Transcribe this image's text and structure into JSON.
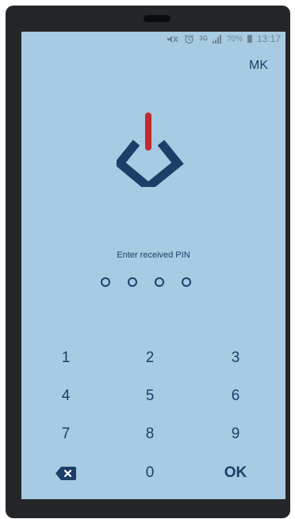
{
  "status_bar": {
    "icons": [
      "mute-icon",
      "alarm-icon",
      "network-3g-icon",
      "signal-icon",
      "battery-icon"
    ],
    "network_label": "3G",
    "battery_percent": "70%",
    "time": "13:17"
  },
  "header": {
    "user_initials": "MK"
  },
  "logo": {
    "name": "power-diamond-logo",
    "colors": {
      "diamond": "#1c3f6a",
      "bar": "#c2282e"
    }
  },
  "pin": {
    "prompt": "Enter received PIN",
    "length": 4,
    "entered": 0
  },
  "keypad": {
    "keys": [
      "1",
      "2",
      "3",
      "4",
      "5",
      "6",
      "7",
      "8",
      "9",
      "",
      "0",
      "OK"
    ],
    "backspace_icon": "backspace-icon"
  },
  "colors": {
    "background": "#a6cbe2",
    "text": "#1c3f6a",
    "accent": "#c2282e"
  }
}
